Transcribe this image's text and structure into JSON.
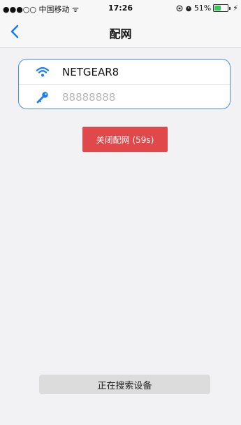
{
  "status_bar": {
    "signal_and_carrier": "●●●○○ 中国移动 ᯤ",
    "time": "17:26",
    "icons": [
      "rotation-lock-icon",
      "alarm-icon"
    ],
    "battery_text": "51%",
    "battery_level": 0.51,
    "charging_symbol": "⚡"
  },
  "nav": {
    "back_icon": "chevron-left-icon",
    "title": "配网"
  },
  "form": {
    "ssid_icon": "wifi-icon",
    "ssid_value": "NETGEAR8",
    "password_icon": "key-icon",
    "password_value": "88888888",
    "accent_color": "#4a90e2"
  },
  "actions": {
    "close_config_label": "关闭配网 (59s)",
    "close_config_color": "#e0484a",
    "searching_label": "正在搜索设备"
  }
}
